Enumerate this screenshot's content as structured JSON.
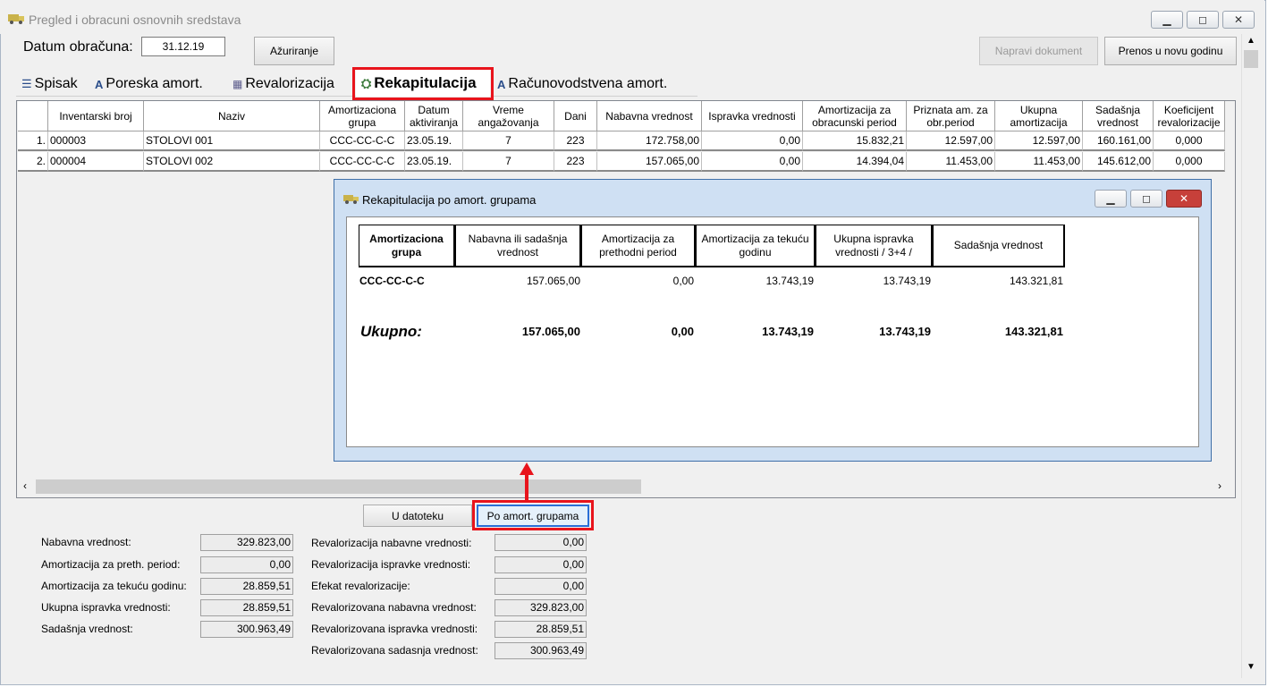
{
  "window": {
    "title": "Pregled i obracuni osnovnih sredstava"
  },
  "toolbar": {
    "date_label": "Datum obračuna:",
    "date_value": "31.12.19",
    "update_button": "Ažuriranje",
    "make_document_button": "Napravi dokument",
    "transfer_button": "Prenos u novu godinu"
  },
  "tabs": [
    {
      "label": "Spisak"
    },
    {
      "label": "Poreska amort."
    },
    {
      "label": "Revalorizacija"
    },
    {
      "label": "Rekapitulacija"
    },
    {
      "label": "Računovodstvena amort."
    }
  ],
  "table": {
    "columns": [
      "Inventarski broj",
      "Naziv",
      "Amortizaciona grupa",
      "Datum aktiviranja",
      "Vreme angažovanja",
      "Dani",
      "Nabavna vrednost",
      "Ispravka vrednosti",
      "Amortizacija za obracunski period",
      "Priznata am. za obr.period",
      "Ukupna amortizacija",
      "Sadašnja vrednost",
      "Koeficijent revalorizacije"
    ],
    "rows": [
      {
        "num": "1.",
        "inv": "000003",
        "naziv": "STOLOVI 001",
        "grupa": "CCC-CC-C-C",
        "datum": "23.05.19.",
        "vreme": "7",
        "dani": "223",
        "nabavna": "172.758,00",
        "ispravka": "0,00",
        "amort_period": "15.832,21",
        "priznata": "12.597,00",
        "ukupna": "12.597,00",
        "sadasnja": "160.161,00",
        "koef": "0,000"
      },
      {
        "num": "2.",
        "inv": "000004",
        "naziv": "STOLOVI 002",
        "grupa": "CCC-CC-C-C",
        "datum": "23.05.19.",
        "vreme": "7",
        "dani": "223",
        "nabavna": "157.065,00",
        "ispravka": "0,00",
        "amort_period": "14.394,04",
        "priznata": "11.453,00",
        "ukupna": "11.453,00",
        "sadasnja": "145.612,00",
        "koef": "0,000"
      }
    ]
  },
  "dialog": {
    "title": "Rekapitulacija po amort. grupama",
    "columns": [
      "Amortizaciona grupa",
      "Nabavna ili sadašnja vrednost",
      "Amortizacija za prethodni period",
      "Amortizacija za tekuću godinu",
      "Ukupna ispravka vrednosti / 3+4 /",
      "Sadašnja vrednost"
    ],
    "row": {
      "grupa": "CCC-CC-C-C",
      "nabavna": "157.065,00",
      "prethodni": "0,00",
      "tekuca": "13.743,19",
      "ukupna": "13.743,19",
      "sadasnja": "143.321,81"
    },
    "total": {
      "label": "Ukupno:",
      "nabavna": "157.065,00",
      "prethodni": "0,00",
      "tekuca": "13.743,19",
      "ukupna": "13.743,19",
      "sadasnja": "143.321,81"
    }
  },
  "bottom_buttons": {
    "to_file": "U datoteku",
    "by_group": "Po amort. grupama"
  },
  "summary_left": [
    {
      "label": "Nabavna vrednost:",
      "value": "329.823,00"
    },
    {
      "label": "Amortizacija za preth. period:",
      "value": "0,00"
    },
    {
      "label": "Amortizacija za tekuću godinu:",
      "value": "28.859,51"
    },
    {
      "label": "Ukupna ispravka vrednosti:",
      "value": "28.859,51"
    },
    {
      "label": "Sadašnja vrednost:",
      "value": "300.963,49"
    }
  ],
  "summary_right": [
    {
      "label": "Revalorizacija nabavne vrednosti:",
      "value": "0,00"
    },
    {
      "label": "Revalorizacija ispravke vrednosti:",
      "value": "0,00"
    },
    {
      "label": "Efekat revalorizacije:",
      "value": "0,00"
    },
    {
      "label": "Revalorizovana nabavna vrednost:",
      "value": "329.823,00"
    },
    {
      "label": "Revalorizovana ispravka vrednosti:",
      "value": "28.859,51"
    },
    {
      "label": "Revalorizovana sadasnja vrednost:",
      "value": "300.963,49"
    }
  ],
  "colors": {
    "highlight_red": "#e8141c",
    "selected_tab_bg": "#ffffff",
    "dialog_frame": "#cfe0f3",
    "close_red": "#c7403a"
  }
}
